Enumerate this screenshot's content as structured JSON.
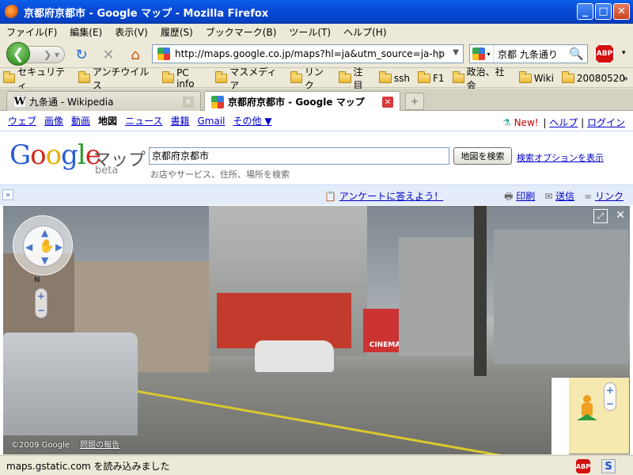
{
  "window": {
    "title": "京都府京都市 - Google マップ - Mozilla Firefox"
  },
  "menu": [
    "ファイル(F)",
    "編集(E)",
    "表示(V)",
    "履歴(S)",
    "ブックマーク(B)",
    "ツール(T)",
    "ヘルプ(H)"
  ],
  "nav": {
    "url": "http://maps.google.co.jp/maps?hl=ja&utm_source=ja-hp",
    "search_value": "京都 九条通り",
    "abp_label": "ABP"
  },
  "bookmarks": [
    "セキュリティ",
    "アンチウイルス",
    "PC info",
    "マスメディア",
    "リンク",
    "注目",
    "ssh",
    "F1",
    "政治、社会",
    "Wiki",
    "20080520"
  ],
  "bookmarks_more": "»",
  "tabs": [
    {
      "label": "九条通 - Wikipedia",
      "active": false
    },
    {
      "label": "京都府京都市 - Google マップ",
      "active": true
    }
  ],
  "gbar": {
    "links": [
      "ウェブ",
      "画像",
      "動画"
    ],
    "current": "地図",
    "links2": [
      "ニュース",
      "書籍",
      "Gmail",
      "その他 ▼"
    ],
    "new_label": "New!",
    "help": "ヘルプ",
    "login": "ログイン",
    "separator": "|"
  },
  "header": {
    "maps_word": "マップ",
    "beta": "beta",
    "query": "京都府京都市",
    "search_button": "地図を検索",
    "options_link": "検索オプションを表示",
    "hint": "お店やサービス、住所、場所を検索"
  },
  "mapbar": {
    "chevron": "»",
    "survey": "アンケートに答えよう！",
    "print": "印刷",
    "send": "送信",
    "link": "リンク"
  },
  "street": {
    "compass_n": "N",
    "zoom_in": "+",
    "zoom_out": "−",
    "copyright": "©2009 Google",
    "report": "問題の報告",
    "cinema": "CINEMA"
  },
  "status": {
    "text": "maps.gstatic.com を読み込みました"
  },
  "colors": {
    "titlebar": "#0341c6",
    "link": "#0000cc",
    "mapbar_bg": "#e5ecf9"
  }
}
